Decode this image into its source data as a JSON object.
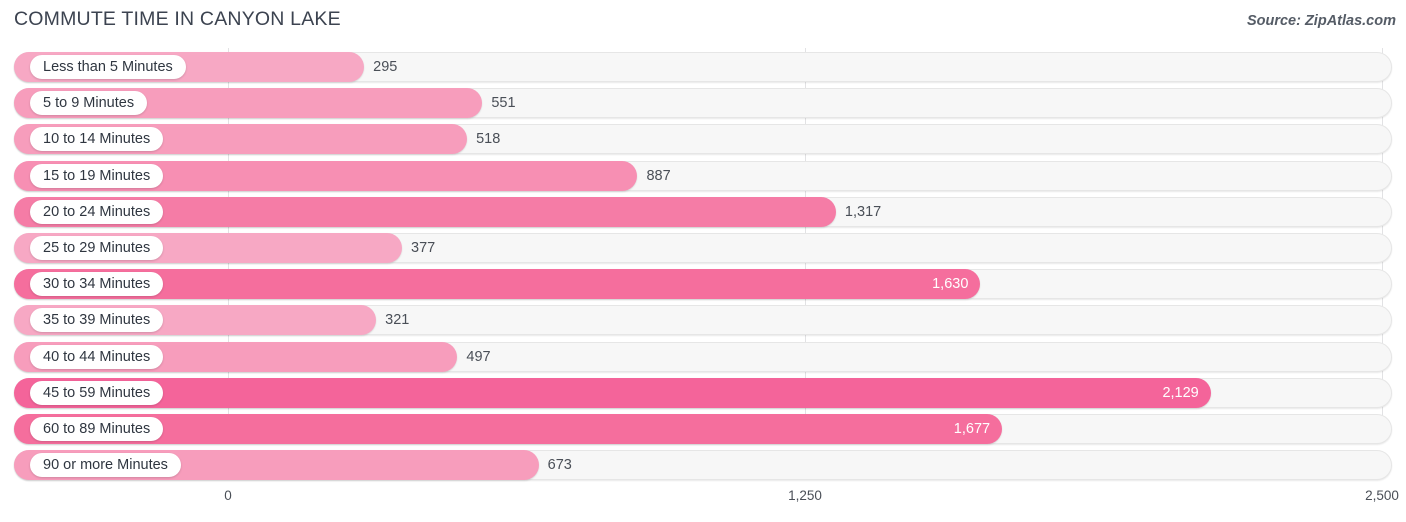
{
  "header": {
    "title": "COMMUTE TIME IN CANYON LAKE",
    "source": "Source: ZipAtlas.com"
  },
  "chart_data": {
    "type": "bar",
    "orientation": "horizontal",
    "title": "COMMUTE TIME IN CANYON LAKE",
    "xlabel": "",
    "ylabel": "",
    "xlim": [
      0,
      2500
    ],
    "grid": true,
    "legend": null,
    "tick_labels": [
      "0",
      "1,250",
      "2,500"
    ],
    "ticks": [
      0,
      1250,
      2500
    ],
    "categories": [
      "Less than 5 Minutes",
      "5 to 9 Minutes",
      "10 to 14 Minutes",
      "15 to 19 Minutes",
      "20 to 24 Minutes",
      "25 to 29 Minutes",
      "30 to 34 Minutes",
      "35 to 39 Minutes",
      "40 to 44 Minutes",
      "45 to 59 Minutes",
      "60 to 89 Minutes",
      "90 or more Minutes"
    ],
    "values": [
      295,
      551,
      518,
      887,
      1317,
      377,
      1630,
      321,
      497,
      2129,
      1677,
      673
    ],
    "value_labels": [
      "295",
      "551",
      "518",
      "887",
      "1,317",
      "377",
      "1,630",
      "321",
      "497",
      "2,129",
      "1,677",
      "673"
    ],
    "bar_colors": [
      "#f7a8c4",
      "#f79dbc",
      "#f79dbc",
      "#f78fb3",
      "#f57ca6",
      "#f7a8c4",
      "#f56e9d",
      "#f7a8c4",
      "#f79dbc",
      "#f4649a",
      "#f56e9d",
      "#f79dbc"
    ],
    "label_inside": [
      false,
      false,
      false,
      false,
      false,
      false,
      true,
      false,
      false,
      true,
      true,
      false
    ],
    "colors": {
      "track": "#f7f7f7",
      "track_border": "#e6e6e6",
      "gridline": "#e2e2e4",
      "text": "#4a4f57",
      "title": "#3c4350",
      "label_pill": "#ffffff"
    }
  }
}
